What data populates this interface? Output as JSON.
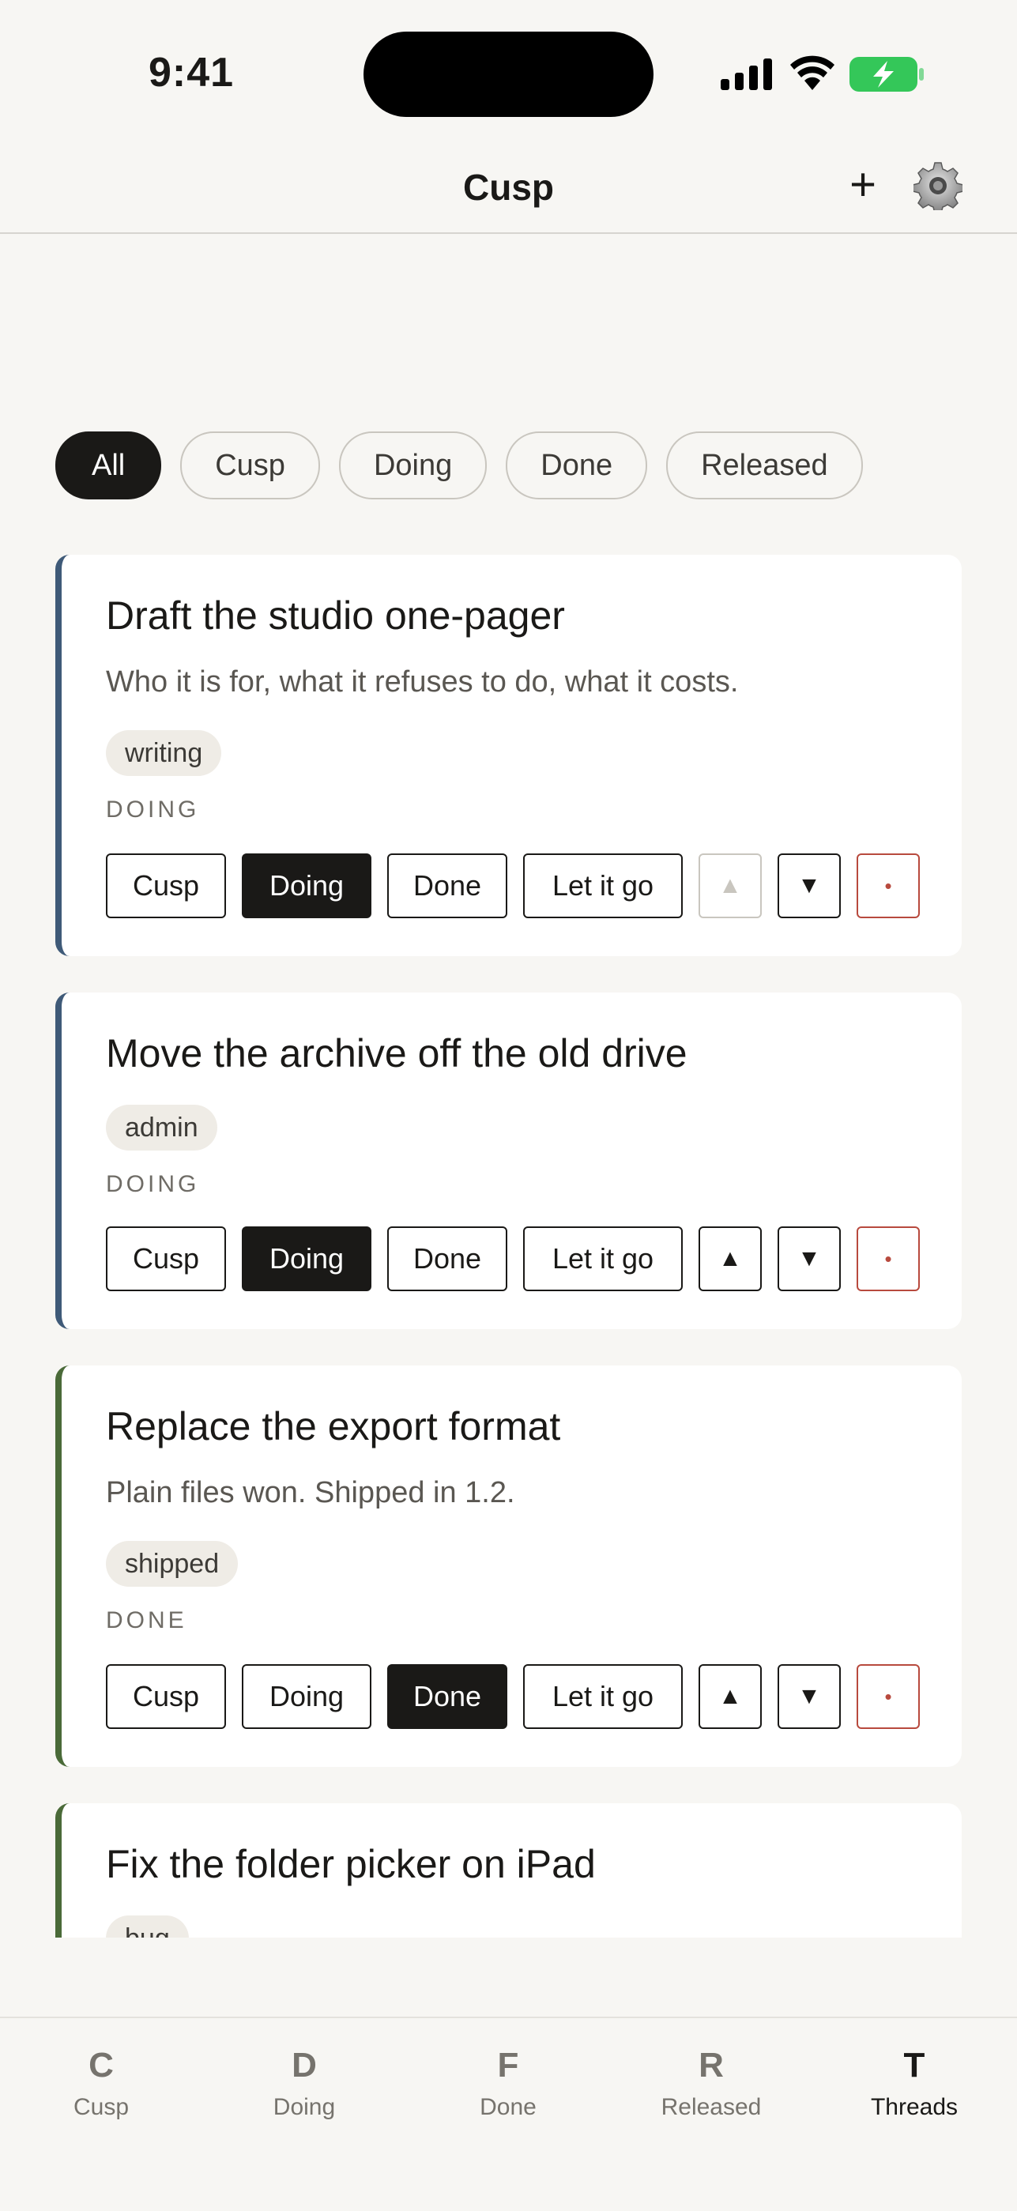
{
  "status": {
    "time": "9:41"
  },
  "nav": {
    "title": "Cusp",
    "add_label": "+"
  },
  "filters": [
    "All",
    "Cusp",
    "Doing",
    "Done",
    "Released"
  ],
  "cards": [
    {
      "title": "Draft the studio one-pager",
      "description": "Who it is for, what it refuses to do, what it costs.",
      "tag": "writing",
      "state": "DOING"
    },
    {
      "title": "Move the archive off the old drive",
      "tag": "admin",
      "state": "DOING"
    },
    {
      "title": "Replace the export format",
      "description": "Plain files won. Shipped in 1.2.",
      "tag": "shipped",
      "state": "DONE"
    },
    {
      "title": "Fix the folder picker on iPad",
      "tag": "bug"
    }
  ],
  "actions": {
    "cusp": "Cusp",
    "doing": "Doing",
    "done": "Done",
    "let_go": "Let it go",
    "up": "▲",
    "down": "▼",
    "remove": "•"
  },
  "tabs": [
    {
      "glyph": "C",
      "label": "Cusp"
    },
    {
      "glyph": "D",
      "label": "Doing"
    },
    {
      "glyph": "F",
      "label": "Done"
    },
    {
      "glyph": "R",
      "label": "Released"
    },
    {
      "glyph": "T",
      "label": "Threads"
    }
  ],
  "colors": {
    "accent_doing": "#3f5a78",
    "accent_done": "#4a6a38",
    "danger": "#b84a3e",
    "battery": "#34c759"
  },
  "icons": {
    "nav_settings": "gear-icon",
    "status": [
      "cellular-signal-icon",
      "wifi-icon",
      "battery-charging-icon"
    ]
  }
}
